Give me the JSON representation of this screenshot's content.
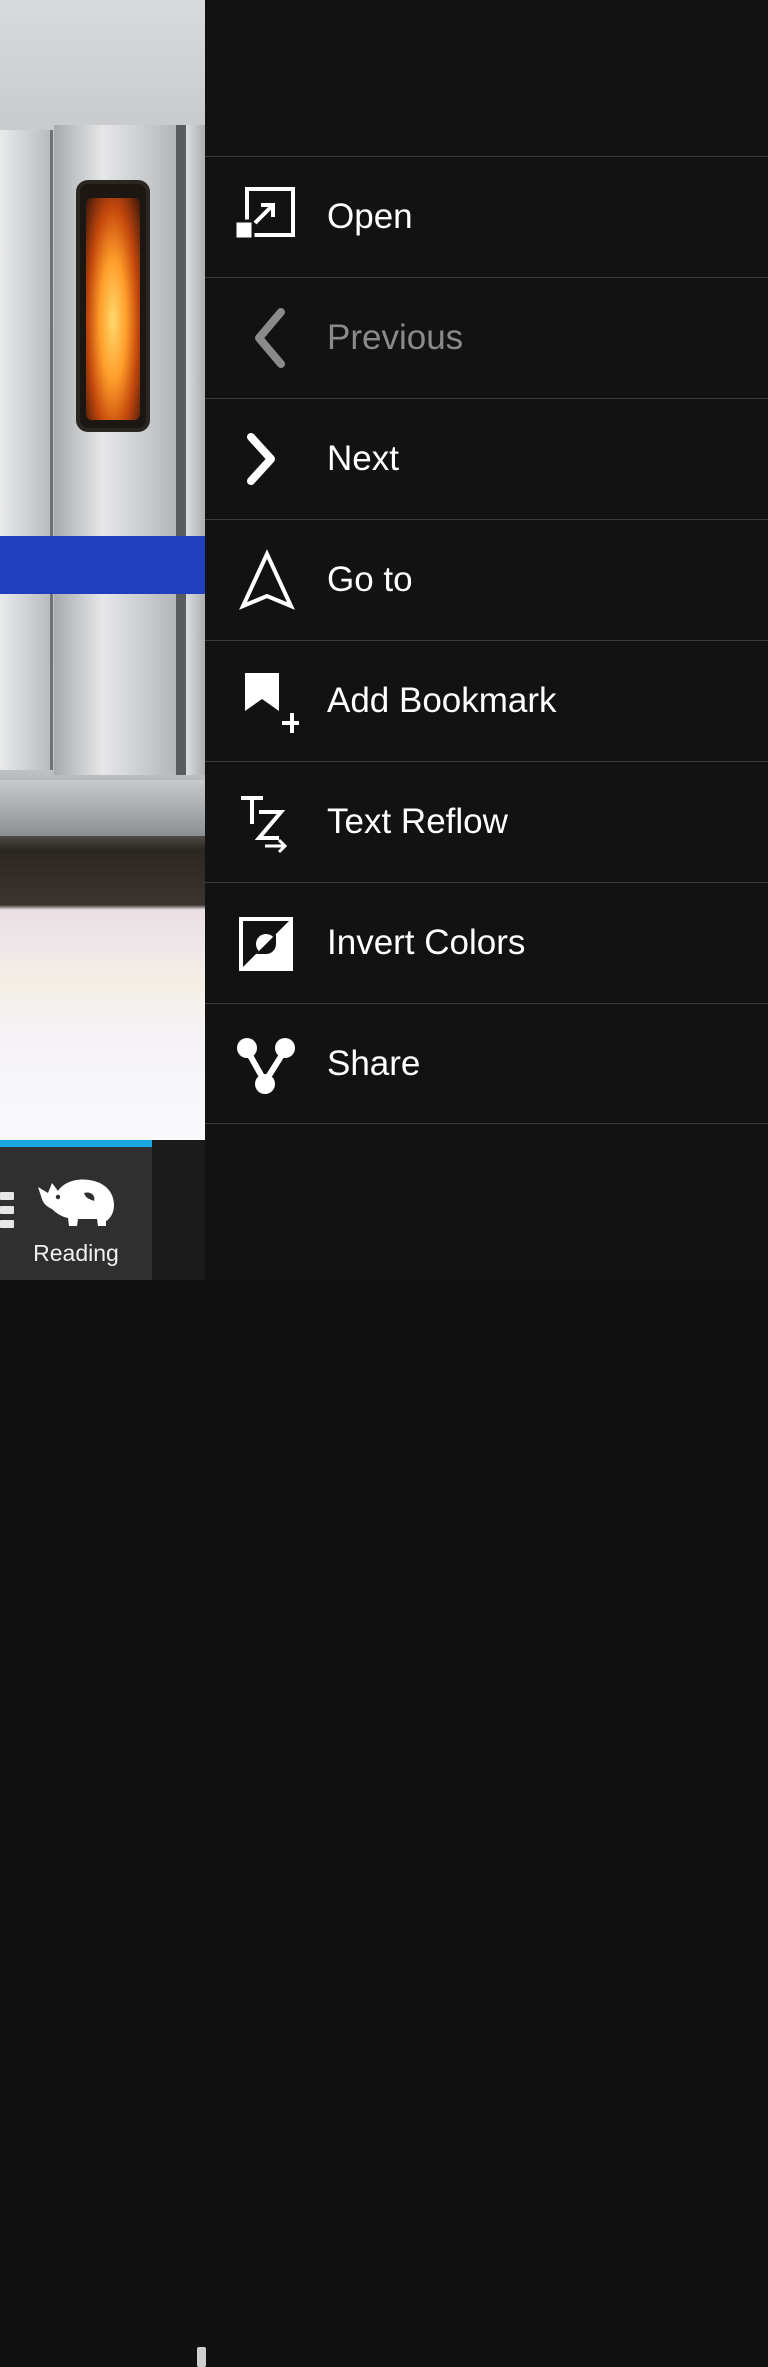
{
  "background_page": {
    "description_icon": "train-photo",
    "stripe_color": "#1f3fbf"
  },
  "bottom_bar": {
    "active_tab": {
      "label": "Reading",
      "icon": "rhino-icon",
      "accent_color": "#1aa6e0"
    }
  },
  "menu": {
    "items": [
      {
        "label": "Open",
        "icon": "open-icon",
        "enabled": true
      },
      {
        "label": "Previous",
        "icon": "chevron-left-icon",
        "enabled": false
      },
      {
        "label": "Next",
        "icon": "chevron-right-icon",
        "enabled": true
      },
      {
        "label": "Go to",
        "icon": "navigate-icon",
        "enabled": true
      },
      {
        "label": "Add Bookmark",
        "icon": "bookmark-add-icon",
        "enabled": true
      },
      {
        "label": "Text Reflow",
        "icon": "text-reflow-icon",
        "enabled": true
      },
      {
        "label": "Invert Colors",
        "icon": "invert-colors-icon",
        "enabled": true
      },
      {
        "label": "Share",
        "icon": "share-icon",
        "enabled": true
      }
    ]
  }
}
